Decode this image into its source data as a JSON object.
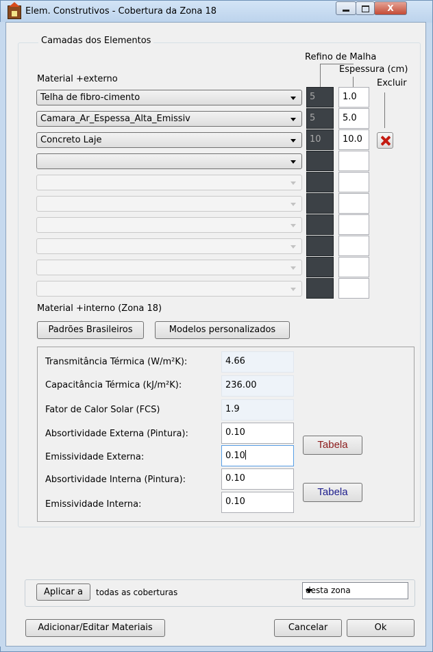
{
  "window": {
    "title": "Elem. Construtivos - Cobertura da Zona 18",
    "minimize_glyph": "",
    "maximize_glyph": "",
    "close_glyph": "X"
  },
  "layers": {
    "legend": "Camadas dos Elementos",
    "refino_header": "Refino de Malha",
    "espessura_header": "Espessura (cm)",
    "excluir_header": "Excluir",
    "outer_label": "Material +externo",
    "inner_label": "Material +interno (Zona 18)",
    "rows": [
      {
        "material": "Telha de fibro-cimento",
        "refino": "5",
        "espessura": "1.0"
      },
      {
        "material": "Camara_Ar_Espessa_Alta_Emissiv",
        "refino": "5",
        "espessura": "5.0"
      },
      {
        "material": "Concreto Laje",
        "refino": "10",
        "espessura": "10.0"
      },
      {
        "material": "",
        "refino": "",
        "espessura": ""
      },
      {
        "material": "",
        "refino": "",
        "espessura": ""
      },
      {
        "material": "",
        "refino": "",
        "espessura": ""
      },
      {
        "material": "",
        "refino": "",
        "espessura": ""
      },
      {
        "material": "",
        "refino": "",
        "espessura": ""
      },
      {
        "material": "",
        "refino": "",
        "espessura": ""
      },
      {
        "material": "",
        "refino": "",
        "espessura": ""
      }
    ],
    "padroes_button": "Padrões Brasileiros",
    "modelos_button": "Modelos personalizados"
  },
  "properties": {
    "transmitancia_label": "Transmitância Térmica (W/m²K):",
    "transmitancia_value": "4.66",
    "capacitancia_label": "Capacitância Térmica (kJ/m²K):",
    "capacitancia_value": "236.00",
    "fcs_label": "Fator de Calor Solar (FCS)",
    "fcs_value": "1.9",
    "abs_ext_label": "Absortividade Externa (Pintura):",
    "abs_ext_value": "0.10",
    "emis_ext_label": "Emissividade Externa:",
    "emis_ext_value": "0.10",
    "abs_int_label": "Absortividade Interna (Pintura):",
    "abs_int_value": "0.10",
    "emis_int_label": "Emissividade Interna:",
    "emis_int_value": "0.10",
    "tabela_ext_label": "Tabela",
    "tabela_int_label": "Tabela",
    "tabela_ext_color": "#8b1a1a",
    "tabela_int_color": "#1a1a8b"
  },
  "apply": {
    "button": "Aplicar a",
    "text": "todas as coberturas",
    "scope_selected": "desta zona"
  },
  "footer": {
    "edit_materials": "Adicionar/Editar Materiais",
    "cancel": "Cancelar",
    "ok": "Ok"
  }
}
